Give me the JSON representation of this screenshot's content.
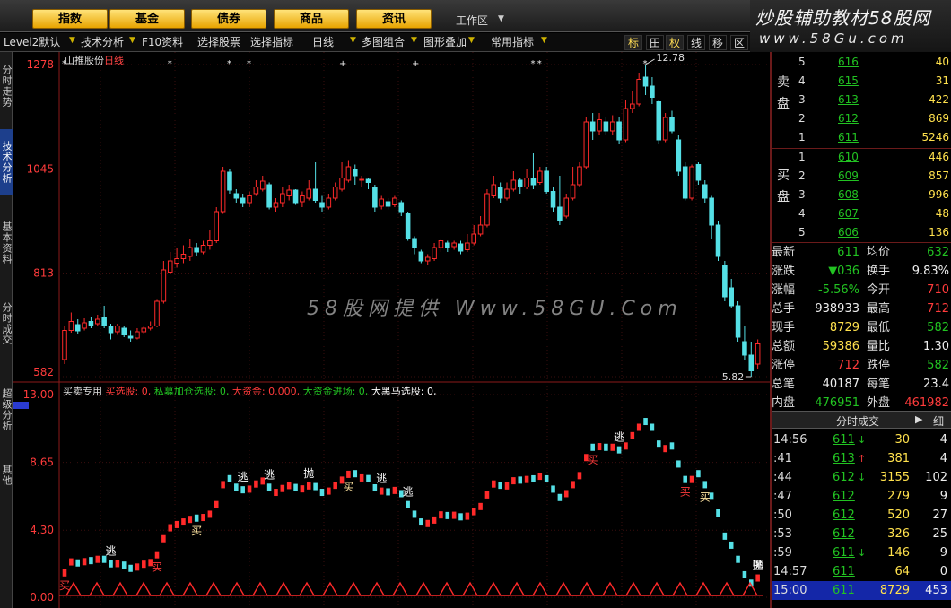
{
  "top_tabs": [
    "指数",
    "基金",
    "债券",
    "商品",
    "资讯"
  ],
  "workspace": "工作区",
  "brand": {
    "title": "炒股辅助教材58股网",
    "url": "www.58Gu.com"
  },
  "toolbar": {
    "items": [
      "Level2默认",
      "技术分析",
      "F10资料",
      "选择股票",
      "选择指标",
      "日线",
      "多图组合",
      "图形叠加",
      "常用指标"
    ],
    "icons": [
      "标",
      "田",
      "权",
      "线",
      "移",
      "区"
    ]
  },
  "vtabs": [
    "分时走势",
    "技术分析",
    "基本资料",
    "分时成交",
    "超级分析",
    "其他"
  ],
  "stock": {
    "name": "山推股份",
    "period": "日线"
  },
  "price_axis": [
    "1278",
    "1045",
    "813",
    "582"
  ],
  "indicator_axis": [
    "13.00",
    "8.65",
    "4.30",
    "0.00"
  ],
  "high_label": "12.78",
  "low_label": "5.82",
  "indicator": {
    "name": "买卖专用",
    "items": [
      {
        "text": "买选股: 0,",
        "color": "red"
      },
      {
        "text": "私募加仓选股: 0,",
        "color": "green"
      },
      {
        "text": "大资金: 0.000,",
        "color": "red"
      },
      {
        "text": "大资金进场: 0,",
        "color": "green"
      },
      {
        "text": "大黑马选股: 0,",
        "color": "white"
      }
    ]
  },
  "chart_labels": [
    "买",
    "逃",
    "买",
    "买",
    "逃",
    "逃",
    "抛",
    "买",
    "逃",
    "逃",
    "买",
    "逃",
    "买",
    "买",
    "逃",
    "抛",
    "逃"
  ],
  "watermark": "58股网提供 Www.58GU.Com",
  "orderbook": {
    "sell_label": "卖盘",
    "buy_label": "买盘",
    "sell": [
      {
        "level": "5",
        "price": "616",
        "vol": "40"
      },
      {
        "level": "4",
        "price": "615",
        "vol": "31"
      },
      {
        "level": "3",
        "price": "613",
        "vol": "422"
      },
      {
        "level": "2",
        "price": "612",
        "vol": "869"
      },
      {
        "level": "1",
        "price": "611",
        "vol": "5246"
      }
    ],
    "buy": [
      {
        "level": "1",
        "price": "610",
        "vol": "446"
      },
      {
        "level": "2",
        "price": "609",
        "vol": "857"
      },
      {
        "level": "3",
        "price": "608",
        "vol": "996"
      },
      {
        "level": "4",
        "price": "607",
        "vol": "48"
      },
      {
        "level": "5",
        "price": "606",
        "vol": "136"
      }
    ]
  },
  "stats": [
    {
      "l1": "最新",
      "v1": "611",
      "c1": "g",
      "l2": "均价",
      "v2": "632",
      "c2": "g"
    },
    {
      "l1": "涨跌",
      "v1": "▼036",
      "c1": "g",
      "l2": "换手",
      "v2": "9.83%",
      "c2": "w"
    },
    {
      "l1": "涨幅",
      "v1": "-5.56%",
      "c1": "g",
      "l2": "今开",
      "v2": "710",
      "c2": "r"
    },
    {
      "l1": "总手",
      "v1": "938933",
      "c1": "w",
      "l2": "最高",
      "v2": "712",
      "c2": "r"
    },
    {
      "l1": "现手",
      "v1": "8729",
      "c1": "y",
      "l2": "最低",
      "v2": "582",
      "c2": "g"
    },
    {
      "l1": "总额",
      "v1": "59386",
      "c1": "y",
      "l2": "量比",
      "v2": "1.30",
      "c2": "w"
    },
    {
      "l1": "涨停",
      "v1": "712",
      "c1": "r",
      "l2": "跌停",
      "v2": "582",
      "c2": "g"
    },
    {
      "l1": "总笔",
      "v1": "40187",
      "c1": "w",
      "l2": "每笔",
      "v2": "23.4",
      "c2": "w"
    },
    {
      "l1": "内盘",
      "v1": "476951",
      "c1": "g",
      "l2": "外盘",
      "v2": "461982",
      "c2": "r"
    }
  ],
  "tick_header": {
    "label": "分时成交",
    "tail": "细"
  },
  "ticks": [
    {
      "time": "14:56",
      "price": "611",
      "arrow": "down",
      "vol": "30",
      "cnt": "4"
    },
    {
      "time": ":41",
      "price": "613",
      "arrow": "up",
      "vol": "381",
      "cnt": "4"
    },
    {
      "time": ":44",
      "price": "612",
      "arrow": "down",
      "vol": "3155",
      "cnt": "102"
    },
    {
      "time": ":47",
      "price": "612",
      "arrow": "",
      "vol": "279",
      "cnt": "9"
    },
    {
      "time": ":50",
      "price": "612",
      "arrow": "",
      "vol": "520",
      "cnt": "27"
    },
    {
      "time": ":53",
      "price": "612",
      "arrow": "",
      "vol": "326",
      "cnt": "25"
    },
    {
      "time": ":59",
      "price": "611",
      "arrow": "down",
      "vol": "146",
      "cnt": "9"
    },
    {
      "time": "14:57",
      "price": "611",
      "arrow": "",
      "vol": "64",
      "cnt": "0"
    },
    {
      "time": "15:00",
      "price": "611",
      "arrow": "",
      "vol": "8729",
      "cnt": "453"
    }
  ],
  "colors": {
    "up": "#ff2a2a",
    "down": "#55e0e6",
    "frame": "#8b1a1a",
    "accent": "#ffe14d"
  },
  "chart_data": {
    "type": "candlestick",
    "y_range": [
      5.82,
      12.78
    ],
    "candles": [
      [
        6.2,
        6.85,
        6.1,
        6.95
      ],
      [
        6.85,
        7.05,
        6.8,
        7.25
      ],
      [
        6.98,
        6.84,
        6.78,
        7.1
      ],
      [
        6.9,
        7.02,
        6.85,
        7.12
      ],
      [
        7.05,
        6.95,
        6.9,
        7.15
      ],
      [
        7.0,
        7.1,
        6.95,
        7.2
      ],
      [
        7.15,
        6.95,
        6.9,
        7.4
      ],
      [
        6.95,
        6.8,
        6.65,
        7.0
      ],
      [
        6.82,
        6.95,
        6.75,
        7.0
      ],
      [
        6.9,
        6.75,
        6.7,
        6.95
      ],
      [
        6.72,
        6.68,
        6.6,
        6.85
      ],
      [
        6.68,
        6.82,
        6.65,
        6.9
      ],
      [
        6.82,
        6.9,
        6.78,
        6.95
      ],
      [
        6.9,
        6.95,
        6.85,
        7.05
      ],
      [
        6.95,
        7.5,
        6.92,
        7.55
      ],
      [
        7.5,
        8.2,
        7.45,
        8.4
      ],
      [
        8.15,
        8.4,
        8.1,
        8.6
      ],
      [
        8.35,
        8.45,
        8.25,
        8.7
      ],
      [
        8.45,
        8.55,
        8.35,
        8.75
      ],
      [
        8.5,
        8.7,
        8.4,
        8.9
      ],
      [
        8.7,
        8.6,
        8.5,
        8.8
      ],
      [
        8.6,
        8.75,
        8.55,
        8.85
      ],
      [
        8.75,
        8.85,
        8.65,
        9.1
      ],
      [
        8.85,
        9.5,
        8.8,
        9.6
      ],
      [
        9.5,
        10.4,
        9.45,
        10.5
      ],
      [
        10.38,
        9.98,
        9.9,
        10.45
      ],
      [
        9.9,
        9.8,
        9.7,
        10.0
      ],
      [
        9.8,
        9.7,
        9.6,
        9.9
      ],
      [
        9.7,
        9.85,
        9.6,
        9.95
      ],
      [
        9.9,
        10.05,
        9.85,
        10.2
      ],
      [
        10.0,
        10.18,
        9.95,
        10.3
      ],
      [
        10.1,
        9.6,
        9.55,
        10.15
      ],
      [
        9.6,
        9.7,
        9.5,
        9.8
      ],
      [
        9.7,
        9.9,
        9.6,
        10.05
      ],
      [
        9.85,
        9.98,
        9.75,
        10.1
      ],
      [
        9.98,
        9.7,
        9.65,
        10.0
      ],
      [
        9.72,
        9.85,
        9.6,
        9.95
      ],
      [
        9.8,
        10.0,
        9.75,
        10.2
      ],
      [
        10.0,
        9.75,
        9.7,
        10.6
      ],
      [
        9.7,
        9.6,
        9.5,
        9.85
      ],
      [
        9.6,
        9.8,
        9.55,
        9.9
      ],
      [
        9.8,
        10.05,
        9.75,
        10.15
      ],
      [
        10.0,
        10.25,
        9.95,
        10.6
      ],
      [
        10.2,
        10.5,
        10.15,
        10.65
      ],
      [
        10.45,
        10.3,
        10.1,
        10.55
      ],
      [
        10.2,
        10.22,
        10.05,
        10.3
      ],
      [
        10.22,
        10.15,
        10.0,
        10.25
      ],
      [
        10.05,
        9.6,
        9.5,
        10.1
      ],
      [
        9.62,
        9.78,
        9.55,
        9.85
      ],
      [
        9.72,
        9.62,
        9.55,
        9.8
      ],
      [
        9.65,
        9.8,
        9.6,
        9.85
      ],
      [
        9.7,
        9.5,
        9.4,
        9.75
      ],
      [
        9.45,
        8.9,
        8.85,
        9.5
      ],
      [
        8.9,
        8.7,
        8.55,
        8.95
      ],
      [
        8.6,
        8.4,
        8.35,
        8.65
      ],
      [
        8.4,
        8.48,
        8.3,
        8.55
      ],
      [
        8.45,
        8.7,
        8.4,
        8.8
      ],
      [
        8.7,
        8.85,
        8.6,
        8.9
      ],
      [
        8.8,
        8.7,
        8.6,
        8.85
      ],
      [
        8.72,
        8.8,
        8.65,
        8.85
      ],
      [
        8.78,
        8.62,
        8.55,
        8.85
      ],
      [
        8.65,
        8.8,
        8.6,
        9.0
      ],
      [
        8.8,
        9.0,
        8.75,
        9.2
      ],
      [
        9.0,
        9.2,
        8.95,
        9.4
      ],
      [
        9.2,
        9.9,
        9.15,
        10.0
      ],
      [
        9.85,
        10.1,
        9.8,
        10.3
      ],
      [
        10.05,
        9.8,
        9.7,
        10.15
      ],
      [
        9.8,
        10.0,
        9.75,
        10.15
      ],
      [
        10.0,
        10.2,
        9.95,
        10.4
      ],
      [
        10.2,
        10.05,
        9.9,
        10.25
      ],
      [
        10.05,
        10.25,
        10.0,
        10.45
      ],
      [
        10.25,
        10.1,
        10.0,
        10.8
      ],
      [
        10.15,
        10.4,
        10.1,
        10.5
      ],
      [
        10.4,
        9.95,
        9.9,
        10.5
      ],
      [
        9.95,
        9.6,
        9.5,
        10.05
      ],
      [
        9.6,
        9.3,
        9.2,
        10.3
      ],
      [
        9.4,
        9.8,
        9.35,
        9.9
      ],
      [
        9.8,
        10.1,
        9.75,
        10.5
      ],
      [
        10.1,
        10.5,
        10.05,
        10.6
      ],
      [
        10.5,
        11.5,
        10.45,
        11.6
      ],
      [
        11.5,
        11.3,
        11.1,
        11.7
      ],
      [
        11.3,
        11.55,
        11.2,
        11.7
      ],
      [
        11.5,
        11.3,
        11.2,
        11.6
      ],
      [
        11.3,
        11.5,
        11.2,
        11.65
      ],
      [
        11.5,
        11.1,
        11.0,
        11.6
      ],
      [
        11.1,
        11.8,
        11.05,
        12.0
      ],
      [
        11.8,
        11.9,
        11.7,
        12.2
      ],
      [
        11.9,
        12.45,
        11.85,
        12.6
      ],
      [
        12.5,
        12.3,
        12.1,
        12.78
      ],
      [
        12.3,
        12.05,
        11.9,
        12.5
      ],
      [
        11.95,
        11.1,
        11.0,
        12.0
      ],
      [
        11.1,
        11.6,
        11.05,
        11.7
      ],
      [
        11.6,
        11.3,
        11.25,
        11.75
      ],
      [
        11.1,
        10.4,
        10.3,
        11.2
      ],
      [
        10.5,
        9.8,
        9.75,
        10.6
      ],
      [
        9.8,
        10.5,
        9.75,
        10.55
      ],
      [
        10.55,
        10.2,
        10.1,
        10.6
      ],
      [
        10.1,
        9.8,
        9.7,
        10.2
      ],
      [
        9.8,
        9.2,
        8.9,
        9.85
      ],
      [
        9.2,
        8.5,
        8.4,
        9.3
      ],
      [
        8.3,
        7.6,
        7.5,
        8.4
      ],
      [
        7.8,
        7.4,
        7.35,
        8.0
      ],
      [
        7.4,
        6.7,
        6.6,
        7.5
      ],
      [
        6.6,
        6.3,
        6.2,
        6.95
      ],
      [
        6.3,
        5.95,
        5.82,
        6.6
      ],
      [
        6.1,
        6.55,
        6.0,
        6.65
      ]
    ],
    "indicator_range": [
      0,
      13
    ],
    "indicator_steps": [
      2,
      2,
      2,
      2,
      2,
      2,
      2,
      2,
      2,
      2,
      2,
      2,
      2,
      2,
      2,
      2,
      0.5,
      1.1,
      0.5,
      1.1,
      0.5,
      1.1,
      0.5,
      1.1,
      0.5,
      1.1,
      0.5,
      1.1,
      0.5,
      1.1,
      0.5,
      1.1,
      0.5,
      1.1,
      0.5,
      1.1,
      0.5,
      1.1,
      0.5,
      1.1,
      0.5,
      1.1,
      0.5,
      1.1,
      0.5,
      1.1,
      0.5,
      1.1,
      0.5,
      1.1,
      0.5,
      1.1,
      0.5,
      1.1,
      0.5,
      1.1,
      0.5,
      1.1,
      0.5,
      1.1,
      0.5,
      1.1,
      0.5,
      1.1,
      0.5,
      1.1,
      0.5,
      1.1,
      0.5,
      1.1,
      0.5,
      1.1,
      0.5,
      1.1,
      0.5,
      1.1,
      0.5,
      1.1,
      0.5,
      1.1,
      0.5,
      1.1,
      0.5,
      1.1,
      0.5,
      1.1,
      0.5,
      1.1,
      0.5,
      1.1,
      0.5,
      1.1,
      0.5,
      1.1,
      0.5,
      1.1,
      0.5,
      1.1,
      0.5,
      1.1,
      0.5,
      1.1,
      0.5,
      1.1,
      0.5,
      1.1,
      0.5,
      1.1
    ]
  }
}
